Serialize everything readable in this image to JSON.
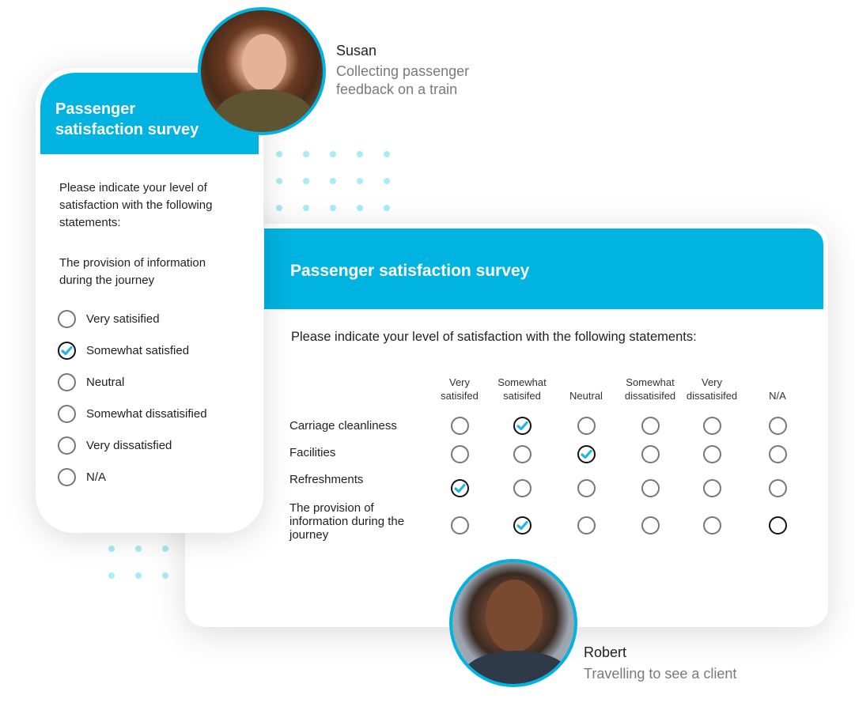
{
  "colors": {
    "accent": "#00b3e1",
    "check": "#1fb6e6",
    "dots": "#a8ecf6",
    "radio_border": "#777777"
  },
  "susan": {
    "name": "Susan",
    "description_line1": "Collecting passenger",
    "description_line2": "feedback on a train",
    "avatar_icon": "person-photo"
  },
  "robert": {
    "name": "Robert",
    "description": "Travelling to see a client",
    "avatar_icon": "person-photo"
  },
  "mobile_survey": {
    "title_line1": "Passenger",
    "title_line2": "satisfaction survey",
    "intro": "Please indicate your level of satisfaction with the following statements:",
    "question": "The provision of information during the journey",
    "options": [
      {
        "label": "Very satisified",
        "checked": false
      },
      {
        "label": "Somewhat satisfied",
        "checked": true
      },
      {
        "label": "Neutral",
        "checked": false
      },
      {
        "label": "Somewhat dissatisified",
        "checked": false
      },
      {
        "label": "Very dissatisfied",
        "checked": false
      },
      {
        "label": "N/A",
        "checked": false
      }
    ]
  },
  "desktop_survey": {
    "title": "Passenger satisfaction survey",
    "intro": "Please indicate your level of satisfaction with the following statements:",
    "columns": [
      {
        "line1": "Very",
        "line2": "satisifed"
      },
      {
        "line1": "Somewhat",
        "line2": "satisifed"
      },
      {
        "line1": "",
        "line2": "Neutral"
      },
      {
        "line1": "Somewhat",
        "line2": "dissatisifed"
      },
      {
        "line1": "Very",
        "line2": "dissatisifed"
      },
      {
        "line1": "",
        "line2": "N/A"
      }
    ],
    "rows": [
      {
        "label": "Carriage cleanliness",
        "selected": 1
      },
      {
        "label": "Facilities",
        "selected": 2
      },
      {
        "label": "Refreshments",
        "selected": 0
      },
      {
        "label": "The provision of information during the journey",
        "selected": 1,
        "focused": 5
      }
    ]
  }
}
